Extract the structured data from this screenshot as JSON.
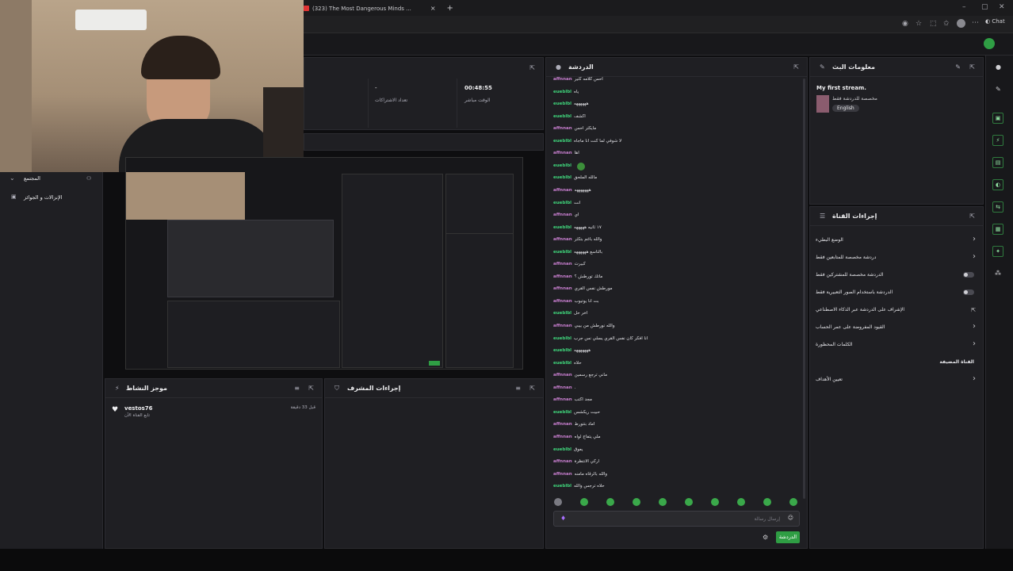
{
  "browser": {
    "tab_title": "(323) The Most Dangerous Minds ..."
  },
  "stats": {
    "uptime_value": "00:48:55",
    "uptime_label": "الوقت مباشر",
    "subs_value": "-",
    "subs_label": "تعداد الاشتراكات"
  },
  "left_nav": {
    "community": "المجتمع",
    "goals": "الإنزالات و الجوائز"
  },
  "activity": {
    "title": "موجز النشاط",
    "item_user": "vestos76",
    "item_desc": "تابع القناة الآن",
    "item_time": "قبل 33 دقيقة"
  },
  "mod_actions": {
    "title": "إجراءات المشرف"
  },
  "chat": {
    "title": "الدردشة",
    "input_placeholder": "إرسال رسالة",
    "send_label": "الدردشة",
    "messages": [
      {
        "user": "affnnan",
        "text": "احس كلامه كثير"
      },
      {
        "user": "eueblbl",
        "text": "ياه"
      },
      {
        "user": "eueblbl",
        "text": "ههههههه"
      },
      {
        "user": "eueblbl",
        "text": "اكشف"
      },
      {
        "user": "affnnan",
        "text": "مايكثر احس"
      },
      {
        "user": "eueblbl",
        "text": "لا شوفي لما كنت انا ماجاه"
      },
      {
        "user": "affnnan",
        "text": "اها"
      },
      {
        "user": "eueblbl",
        "text": ""
      },
      {
        "user": "eueblbl",
        "text": "مالله الملحق"
      },
      {
        "user": "affnnan",
        "text": "هههههههه"
      },
      {
        "user": "eueblbl",
        "text": "انت"
      },
      {
        "user": "affnnan",
        "text": "اي"
      },
      {
        "user": "eueblbl",
        "text": "١٧ ثانيه هههههه"
      },
      {
        "user": "affnnan",
        "text": "والله باغم بتكثر"
      },
      {
        "user": "eueblbl",
        "text": "بالتاسع ههههههه"
      },
      {
        "user": "affnnan",
        "text": "كبيرت"
      },
      {
        "user": "affnnan",
        "text": "ماتك تورطش ؟"
      },
      {
        "user": "affnnan",
        "text": "مورطش نفس القري"
      },
      {
        "user": "affnnan",
        "text": "بت انا يوتيوب"
      },
      {
        "user": "eueblbl",
        "text": "اخر حل"
      },
      {
        "user": "affnnan",
        "text": "والله نورطش من بيبي"
      },
      {
        "user": "eueblbl",
        "text": "انا افكر كان نفس القري يسلي نس جرب"
      },
      {
        "user": "eueblbl",
        "text": "هههههههه"
      },
      {
        "user": "eueblbl",
        "text": "حلاه"
      },
      {
        "user": "affnnan",
        "text": "ماني ترجع رسمين"
      },
      {
        "user": "affnnan",
        "text": "."
      },
      {
        "user": "affnnan",
        "text": "مجد اكتب"
      },
      {
        "user": "eueblbl",
        "text": "حبيت ريكشس"
      },
      {
        "user": "affnnan",
        "text": "اماد بتتورط"
      },
      {
        "user": "affnnan",
        "text": "ملي يتفاج لواه"
      },
      {
        "user": "eueblbl",
        "text": "يعوق"
      },
      {
        "user": "affnnan",
        "text": "اركي الانتظرة"
      },
      {
        "user": "affnnan",
        "text": "والله بالرقاه مامنه"
      },
      {
        "user": "eueblbl",
        "text": "حلاه ترجس والله"
      }
    ]
  },
  "stream_info": {
    "title": "معلومات البث",
    "stream_title": "My first stream.",
    "category": "مخصصة للدردشة فقط",
    "language": "English"
  },
  "channel_actions": {
    "title": "إجراءات القناة",
    "rows": [
      {
        "label": "الوضع البطيء",
        "type": "chevron"
      },
      {
        "label": "دردشة مخصصة للمتابعين فقط",
        "type": "chevron"
      },
      {
        "label": "الدردشة مخصصة للمشتركين فقط",
        "type": "toggle"
      },
      {
        "label": "الدردشة باستخدام الصور التعبيرية فقط",
        "type": "toggle"
      },
      {
        "label": "الإشراف على الدردشة عبر الذكاء الاصطناعي",
        "type": "link"
      },
      {
        "label": "القيود المفروضة على عمر الحساب",
        "type": "chevron"
      },
      {
        "label": "الكلمات المحظورة",
        "type": "chevron"
      },
      {
        "label": "القناة المضيفة",
        "type": "header"
      },
      {
        "label": "تعيين الأهداف",
        "type": "chevron"
      }
    ]
  },
  "colors": {
    "accent_green": "#2f9e44",
    "user_purple": "#c97fd0",
    "user_green": "#3fd37a"
  }
}
